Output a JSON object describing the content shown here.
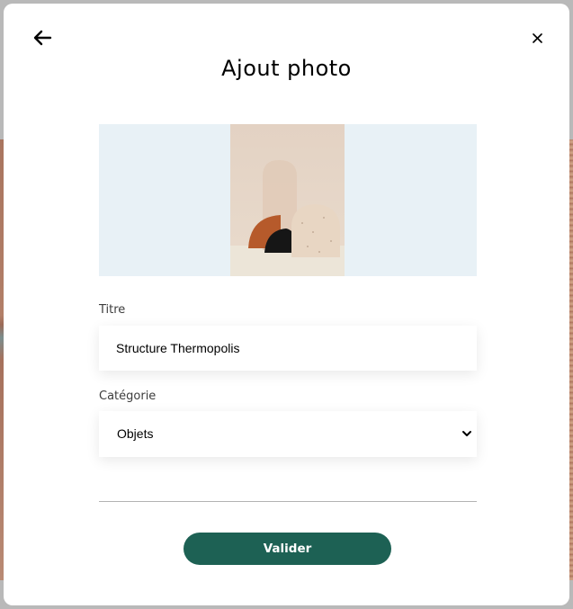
{
  "modal": {
    "title": "Ajout photo",
    "back_icon": "arrow-left-icon",
    "close_icon": "close-icon",
    "close_label": "×"
  },
  "preview": {
    "background_color": "#e8f1f6"
  },
  "form": {
    "title_label": "Titre",
    "title_value": "Structure Thermopolis",
    "category_label": "Catégorie",
    "category_value": "Objets",
    "submit_label": "Valider"
  },
  "colors": {
    "accent": "#1d6154",
    "text": "#000000"
  }
}
